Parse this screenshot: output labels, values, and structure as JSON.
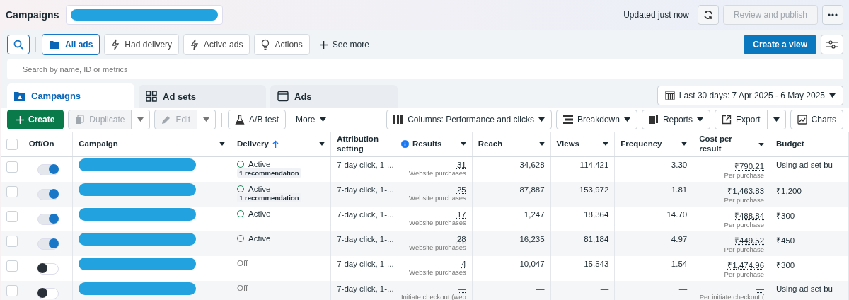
{
  "header": {
    "title": "Campaigns",
    "updated": "Updated just now",
    "review_button": {
      "label": "Review and publish",
      "disabled": true
    }
  },
  "filters": [
    {
      "label": "All ads",
      "selected": true
    },
    {
      "label": "Had delivery",
      "selected": false
    },
    {
      "label": "Active ads",
      "selected": false
    },
    {
      "label": "Actions",
      "selected": false
    }
  ],
  "see_more": "See more",
  "create_view": "Create a view",
  "search": {
    "placeholder": "Search by name, ID or metrics"
  },
  "tabs": [
    {
      "label": "Campaigns",
      "selected": true
    },
    {
      "label": "Ad sets",
      "selected": false
    },
    {
      "label": "Ads",
      "selected": false
    }
  ],
  "date_range": "Last 30 days: 7 Apr 2025 - 6 May 2025",
  "toolbar": {
    "create": "Create",
    "duplicate": {
      "label": "Duplicate",
      "disabled": true
    },
    "edit": {
      "label": "Edit",
      "disabled": true
    },
    "ab_test": "A/B test",
    "more": "More",
    "columns": "Columns: Performance and clicks",
    "breakdown": "Breakdown",
    "reports": "Reports",
    "export": "Export",
    "charts": "Charts"
  },
  "table": {
    "all_selected": false,
    "columns": [
      {
        "label": "Off/On",
        "menu": false,
        "sorted": false
      },
      {
        "label": "Campaign",
        "menu": true,
        "sorted": false
      },
      {
        "label": "Delivery",
        "menu": true,
        "sorted": true
      },
      {
        "label": "Attribution setting",
        "menu": false,
        "sorted": false
      },
      {
        "label": "Results",
        "menu": true,
        "sorted": false
      },
      {
        "label": "Reach",
        "menu": true,
        "sorted": false
      },
      {
        "label": "Views",
        "menu": true,
        "sorted": false
      },
      {
        "label": "Frequency",
        "menu": true,
        "sorted": false
      },
      {
        "label": "Cost per result",
        "menu": true,
        "sorted": false
      },
      {
        "label": "Budget",
        "menu": false,
        "sorted": false
      }
    ],
    "rows": [
      {
        "selected": false,
        "on": true,
        "kind": "active",
        "delivery": "Active",
        "recommendation": "1 recommendation",
        "attribution": "7-day click, 1-...",
        "results": "31",
        "results_type": "Website purchases",
        "reach": "34,628",
        "views": "114,421",
        "frequency": "3.30",
        "cost": "₹790.21",
        "cost_type": "Per purchase",
        "budget": "Using ad set bu"
      },
      {
        "selected": false,
        "on": true,
        "kind": "active",
        "delivery": "Active",
        "recommendation": "1 recommendation",
        "attribution": "7-day click, 1-...",
        "results": "25",
        "results_type": "Website purchases",
        "reach": "87,887",
        "views": "153,972",
        "frequency": "1.81",
        "cost": "₹1,463.83",
        "cost_type": "Per purchase",
        "budget": "₹1,200"
      },
      {
        "selected": false,
        "on": true,
        "kind": "active",
        "delivery": "Active",
        "attribution": "7-day click, 1-...",
        "results": "17",
        "results_type": "Website purchases",
        "reach": "1,247",
        "views": "18,364",
        "frequency": "14.70",
        "cost": "₹488.84",
        "cost_type": "Per purchase",
        "budget": "₹300"
      },
      {
        "selected": false,
        "on": true,
        "kind": "active",
        "delivery": "Active",
        "attribution": "7-day click, 1-...",
        "results": "28",
        "results_type": "Website purchases",
        "reach": "16,235",
        "views": "81,184",
        "frequency": "4.97",
        "cost": "₹449.52",
        "cost_type": "Per purchase",
        "budget": "₹450"
      },
      {
        "selected": false,
        "on": false,
        "kind": "off",
        "delivery": "Off",
        "attribution": "7-day click, 1-...",
        "results": "4",
        "results_type": "Website purchases",
        "reach": "10,047",
        "views": "15,543",
        "frequency": "1.54",
        "cost": "₹1,474.96",
        "cost_type": "Per purchase",
        "budget": "₹300"
      },
      {
        "selected": false,
        "on": false,
        "kind": "off",
        "delivery": "Off",
        "attribution": "7-day click, 1-...",
        "results": "—",
        "results_type": "Initiate checkout (web",
        "reach": "—",
        "views": "—",
        "frequency": "—",
        "cost": "—",
        "cost_type": "Per initiate checkout (",
        "budget": "Using ad set bu"
      }
    ]
  }
}
